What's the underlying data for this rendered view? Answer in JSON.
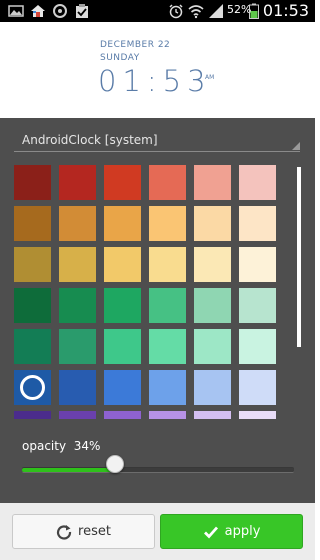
{
  "status_bar": {
    "battery_percent": "52%",
    "time": "01:53"
  },
  "clock_preview": {
    "month_text": "DECEMBER 22",
    "weekday_text": "SUNDAY",
    "time_text": "01:53",
    "ampm_text": "AM",
    "text_color": "#5a7ca8"
  },
  "spinner": {
    "label": "AndroidClock [system]"
  },
  "palette": {
    "selected_row": 5,
    "selected_col": 0,
    "rows": [
      [
        "#8b2019",
        "#b42720",
        "#d03a22",
        "#e56a55",
        "#f0a192",
        "#f4c3bd"
      ],
      [
        "#a66a1e",
        "#d28c36",
        "#e9a548",
        "#fac573",
        "#fbd9a5",
        "#fde5c6"
      ],
      [
        "#b08e33",
        "#d7b049",
        "#f2c969",
        "#f9dc8f",
        "#fbe8b5",
        "#fdf2d8"
      ],
      [
        "#0e6c3a",
        "#178c50",
        "#1ea761",
        "#46c184",
        "#8fd6b2",
        "#b7e4cf"
      ],
      [
        "#137d55",
        "#2a9b6c",
        "#3ec88a",
        "#64dca6",
        "#9de7c6",
        "#c9f3e1"
      ],
      [
        "#1e5aa6",
        "#285cb0",
        "#3c7ad8",
        "#6da1ea",
        "#a7c4f2",
        "#cfdcf8"
      ],
      [
        "#4b2c8c",
        "#6a40ad",
        "#8e62d0",
        "#b792e6",
        "#d4bff2",
        "#e9ddf8"
      ]
    ]
  },
  "opacity": {
    "label": "opacity",
    "value_text": "34%",
    "fraction": 0.34
  },
  "buttons": {
    "reset_label": "reset",
    "apply_label": "apply"
  }
}
